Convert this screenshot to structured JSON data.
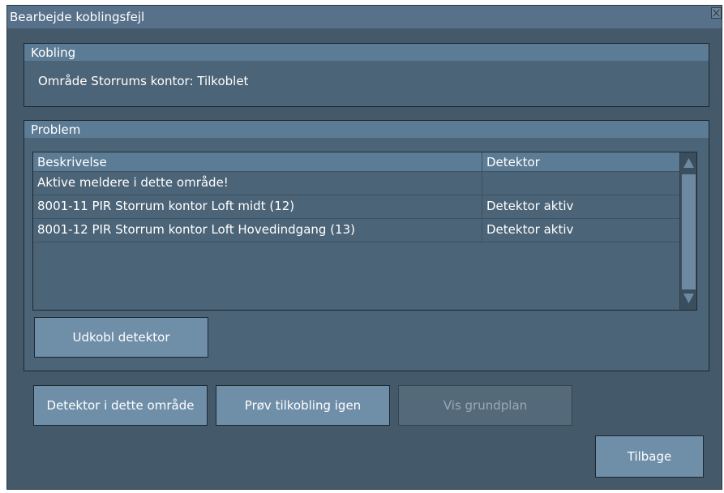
{
  "window": {
    "title": "Bearbejde koblingsfejl"
  },
  "kobling": {
    "header": "Kobling",
    "status_text": "Område Storrums kontor: Tilkoblet"
  },
  "problem": {
    "header": "Problem",
    "columns": [
      "Beskrivelse",
      "Detektor"
    ],
    "rows": [
      {
        "beskrivelse": "Aktive meldere i dette område!",
        "detektor": ""
      },
      {
        "beskrivelse": "8001-11 PIR Storrum kontor Loft midt (12)",
        "detektor": "Detektor aktiv"
      },
      {
        "beskrivelse": "8001-12 PIR Storrum kontor Loft Hovedindgang (13)",
        "detektor": "Detektor aktiv"
      }
    ],
    "disconnect_button": "Udkobl detektor"
  },
  "buttons": {
    "detectors_in_area": "Detektor i dette område",
    "retry_connection": "Prøv tilkobling igen",
    "show_floorplan": "Vis grundplan",
    "back": "Tilbage"
  },
  "colors": {
    "window_bg": "#44596a",
    "header_bg": "#5c7b94",
    "button_bg": "#6f8ea8"
  }
}
